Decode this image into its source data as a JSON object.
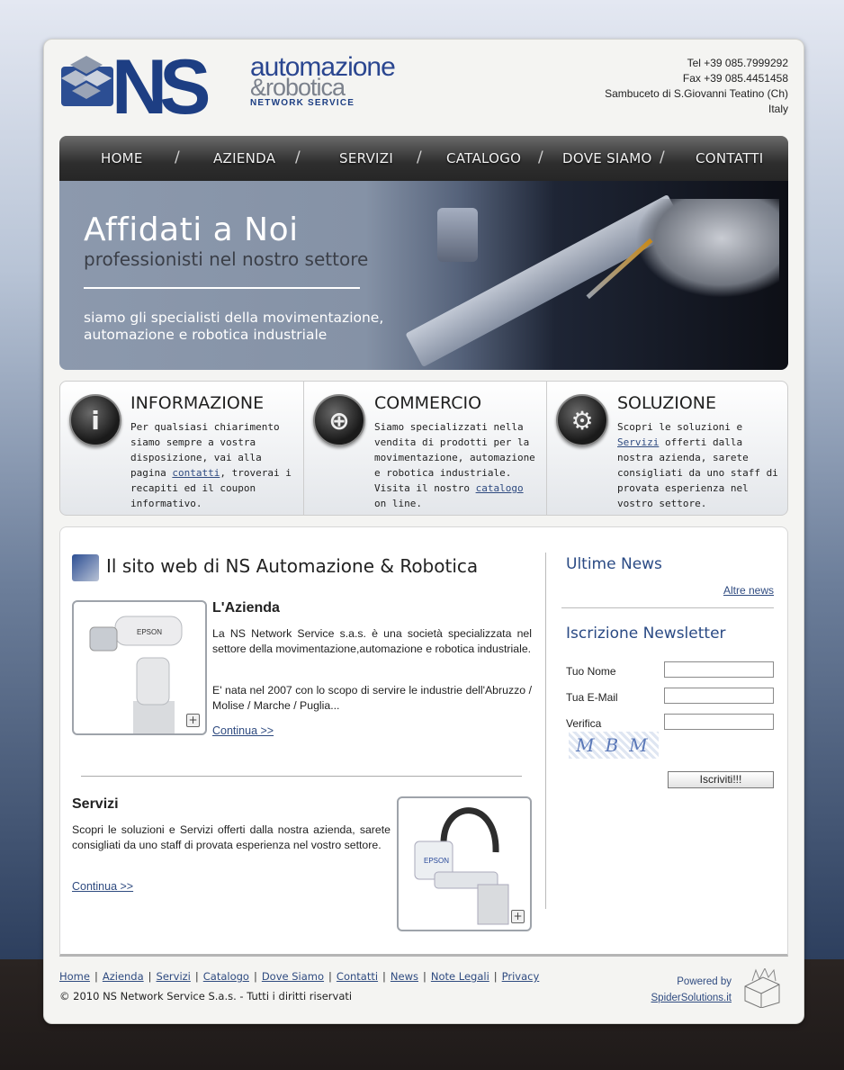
{
  "header": {
    "logo": {
      "mark": "NS",
      "line1": "automazione",
      "line2": "&robotica",
      "line3": "NETWORK SERVICE"
    },
    "contact": [
      "Tel +39 085.7999292",
      "Fax +39 085.4451458",
      "Sambuceto di S.Giovanni Teatino (Ch)",
      "Italy"
    ]
  },
  "nav": {
    "items": [
      "HOME",
      "AZIENDA",
      "SERVIZI",
      "CATALOGO",
      "DOVE SIAMO",
      "CONTATTI"
    ],
    "separator": "/"
  },
  "banner": {
    "title": "Affidati a Noi",
    "subtitle": "professionisti nel nostro settore",
    "desc1": "siamo gli specialisti della movimentazione,",
    "desc2": "automazione e robotica industriale"
  },
  "info": [
    {
      "icon": "info-icon",
      "glyph": "i",
      "title": "INFORMAZIONE",
      "before": "Per qualsiasi chiarimento siamo sempre a vostra disposizione, vai alla pagina ",
      "link": "contatti",
      "after": ", troverai i recapiti ed il coupon informativo."
    },
    {
      "icon": "globe-icon",
      "glyph": "⊕",
      "title": "COMMERCIO",
      "before": "Siamo specializzati nella vendita di prodotti per la movimentazione, automazione e robotica industriale. Visita il nostro ",
      "link": "catalogo",
      "after": " on line."
    },
    {
      "icon": "gear-icon",
      "glyph": "⚙",
      "title": "SOLUZIONE",
      "before": "Scopri le soluzioni e ",
      "link": "Servizi",
      "after": " offerti dalla nostra azienda, sarete consigliati da uno staff di provata esperienza nel vostro settore."
    }
  ],
  "main": {
    "title": "Il sito web di NS Automazione & Robotica",
    "azienda": {
      "heading": "L'Azienda",
      "p1": "La NS Network Service s.a.s. è una società specializzata nel settore della movimentazione,automazione e robotica industriale.",
      "p2": "E' nata nel 2007 con lo scopo di servire le industrie dell'Abruzzo / Molise / Marche / Puglia...",
      "more": "Continua >>",
      "image_label": "EPSON"
    },
    "servizi": {
      "heading": "Servizi",
      "p1": "Scopri le soluzioni e Servizi offerti dalla nostra azienda, sarete consigliati da uno staff di provata esperienza nel vostro settore.",
      "more": "Continua >>",
      "image_label": "EPSON"
    },
    "plus": "+"
  },
  "sidebar": {
    "news_title": "Ultime News",
    "more_news": "Altre news",
    "newsletter_title": "Iscrizione Newsletter",
    "label_name": "Tuo Nome",
    "label_email": "Tua E-Mail",
    "label_verify": "Verifica",
    "captcha": "MBM",
    "submit": "Iscriviti!!!"
  },
  "footer": {
    "links": [
      "Home",
      "Azienda",
      "Servizi",
      "Catalogo",
      "Dove Siamo",
      "Contatti",
      "News",
      "Note Legali",
      "Privacy"
    ],
    "link_separator": "|",
    "copyright": "© 2010 NS Network Service S.a.s. - Tutti i diritti riservati",
    "powered_by": "Powered by",
    "powered_link": "SpiderSolutions.it"
  },
  "colors": {
    "brand": "#1d3e83",
    "link": "#2f4b80",
    "nav_bg": "#2e2e2e"
  }
}
